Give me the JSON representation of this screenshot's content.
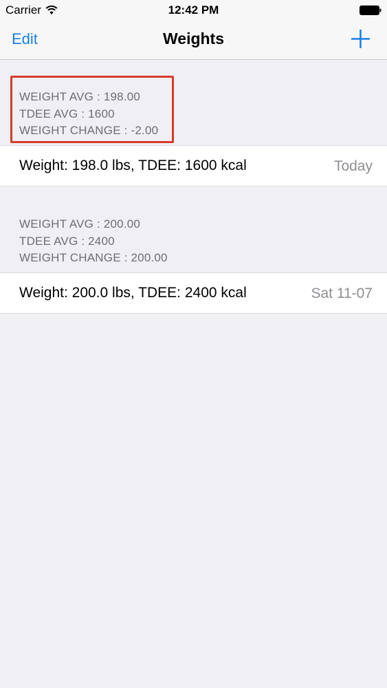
{
  "status_bar": {
    "carrier": "Carrier",
    "time": "12:42 PM"
  },
  "nav": {
    "edit_label": "Edit",
    "title": "Weights",
    "add_icon": "plus-icon"
  },
  "sections": [
    {
      "header_lines": [
        "WEIGHT AVG : 198.00",
        "TDEE AVG : 1600",
        "WEIGHT CHANGE : -2.00"
      ],
      "row": {
        "title": "Weight: 198.0 lbs, TDEE: 1600 kcal",
        "detail": "Today"
      }
    },
    {
      "header_lines": [
        "WEIGHT AVG : 200.00",
        "TDEE AVG : 2400",
        "WEIGHT CHANGE : 200.00"
      ],
      "row": {
        "title": "Weight: 200.0 lbs, TDEE: 2400 kcal",
        "detail": "Sat 11-07"
      }
    }
  ],
  "colors": {
    "accent": "#1a7ee6",
    "highlight": "#d63a2b",
    "background": "#efeff4",
    "secondary_text": "#6d6d72"
  }
}
